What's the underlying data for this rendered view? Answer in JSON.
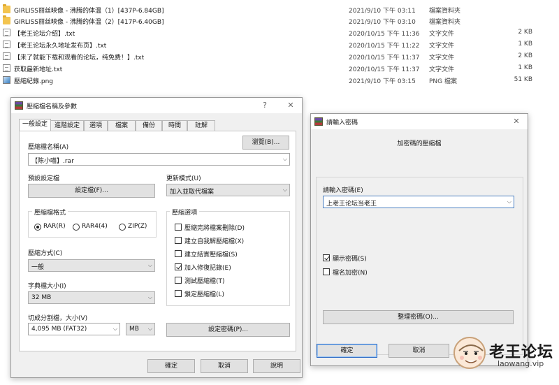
{
  "files": [
    {
      "name": "GIRLISS丽丝映像 - 沸腾的体温（1）[437P-6.84GB]",
      "date": "2021/9/10 下午 03:11",
      "type": "檔案資料夾",
      "size": "",
      "icon": "folder-icon"
    },
    {
      "name": "GIRLISS丽丝映像 - 沸腾的体温（2）[417P-6.40GB]",
      "date": "2021/9/10 下午 03:10",
      "type": "檔案資料夾",
      "size": "",
      "icon": "folder-icon"
    },
    {
      "name": "【老王论坛介绍】.txt",
      "date": "2020/10/15 下午 11:36",
      "type": "文字文件",
      "size": "2 KB",
      "icon": "text-file-icon"
    },
    {
      "name": "【老王论坛永久地址发布页】.txt",
      "date": "2020/10/15 下午 11:22",
      "type": "文字文件",
      "size": "1 KB",
      "icon": "text-file-icon"
    },
    {
      "name": "【来了就能下载和观看的论坛，纯免费！】.txt",
      "date": "2020/10/15 下午 11:37",
      "type": "文字文件",
      "size": "2 KB",
      "icon": "text-file-icon"
    },
    {
      "name": "获取最新地址.txt",
      "date": "2020/10/15 下午 11:37",
      "type": "文字文件",
      "size": "1 KB",
      "icon": "text-file-icon"
    },
    {
      "name": "壓縮紀錄.png",
      "date": "2021/9/10 下午 03:15",
      "type": "PNG 檔案",
      "size": "51 KB",
      "icon": "image-file-icon"
    }
  ],
  "archive_dialog": {
    "title": "壓縮檔名稱及參數",
    "help": "?",
    "close": "✕",
    "tabs": [
      "一般設定",
      "進階設定",
      "選項",
      "檔案",
      "備份",
      "時間",
      "註解"
    ],
    "archive_name_label": "壓縮檔名稱(A)",
    "browse_button": "瀏覽(B)...",
    "archive_name_value": "【陈小喵】.rar",
    "profile_label": "預設設定檔",
    "profiles_button": "設定檔(F)...",
    "update_mode_label": "更新模式(U)",
    "update_mode_value": "加入並取代檔案",
    "format_group": "壓縮檔格式",
    "formats": [
      "RAR(R)",
      "RAR4(4)",
      "ZIP(Z)"
    ],
    "selected_format": "RAR(R)",
    "options_group": "壓縮選項",
    "options": [
      {
        "label": "壓縮完將檔案刪除(D)",
        "checked": false
      },
      {
        "label": "建立自我解壓縮檔(X)",
        "checked": false
      },
      {
        "label": "建立結實壓縮檔(S)",
        "checked": false
      },
      {
        "label": "加入修復記錄(E)",
        "checked": true
      },
      {
        "label": "測試壓縮檔(T)",
        "checked": false
      },
      {
        "label": "鎖定壓縮檔(L)",
        "checked": false
      }
    ],
    "method_label": "壓縮方式(C)",
    "method_value": "一般",
    "dict_label": "字典檔大小(I)",
    "dict_value": "32 MB",
    "split_label": "切成分割檔，大小(V)",
    "split_value": "4,095 MB  (FAT32)",
    "split_unit": "MB",
    "set_password_button": "設定密碼(P)...",
    "ok": "確定",
    "cancel": "取消",
    "help_button": "說明"
  },
  "password_dialog": {
    "title": "請輸入密碼",
    "close": "✕",
    "heading": "加密碼的壓縮檔",
    "prompt": "請輸入密碼(E)",
    "password_value": "上老王论坛当老王",
    "show_password": {
      "label": "顯示密碼(S)",
      "checked": true
    },
    "encrypt_names": {
      "label": "檔名加密(N)",
      "checked": false
    },
    "organize_button": "整理密碼(O)...",
    "ok": "確定",
    "cancel": "取消"
  },
  "watermark": {
    "name": "老王论坛",
    "url": "laowang.vip"
  },
  "colors": {
    "accent": "#2d6cc6",
    "folder": "#f3c44f",
    "dialog_bg": "#f0f0f0"
  }
}
